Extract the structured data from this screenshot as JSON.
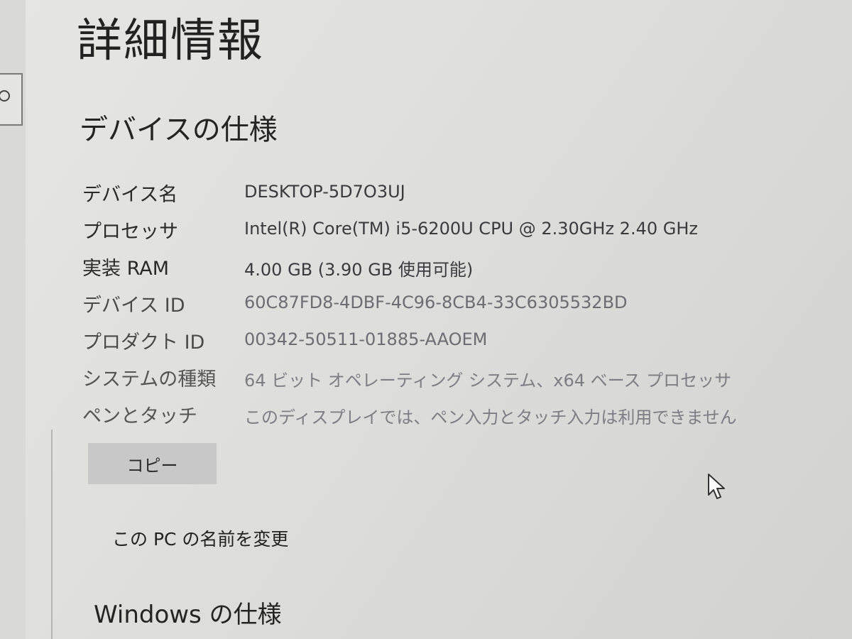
{
  "header": {
    "title": "詳細情報"
  },
  "device_spec": {
    "section_title": "デバイスの仕様",
    "rows": [
      {
        "label": "デバイス名",
        "value": "DESKTOP-5D7O3UJ"
      },
      {
        "label": "プロセッサ",
        "value": "Intel(R) Core(TM) i5-6200U CPU @ 2.30GHz   2.40 GHz"
      },
      {
        "label": "実装 RAM",
        "value": "4.00 GB (3.90 GB 使用可能)"
      },
      {
        "label": "デバイス ID",
        "value": "60C87FD8-4DBF-4C96-8CB4-33C6305532BD"
      },
      {
        "label": "プロダクト ID",
        "value": "00342-50511-01885-AAOEM"
      },
      {
        "label": "システムの種類",
        "value": "64 ビット オペレーティング システム、x64 ベース プロセッサ"
      },
      {
        "label": "ペンとタッチ",
        "value": "このディスプレイでは、ペン入力とタッチ入力は利用できません"
      }
    ],
    "copy_button_label": "コピー",
    "rename_link_label": "この PC の名前を変更"
  },
  "windows_spec": {
    "section_title": "Windows の仕様"
  },
  "icons": {
    "sidebar": "search-icon",
    "pointer": "mouse-cursor-icon"
  }
}
